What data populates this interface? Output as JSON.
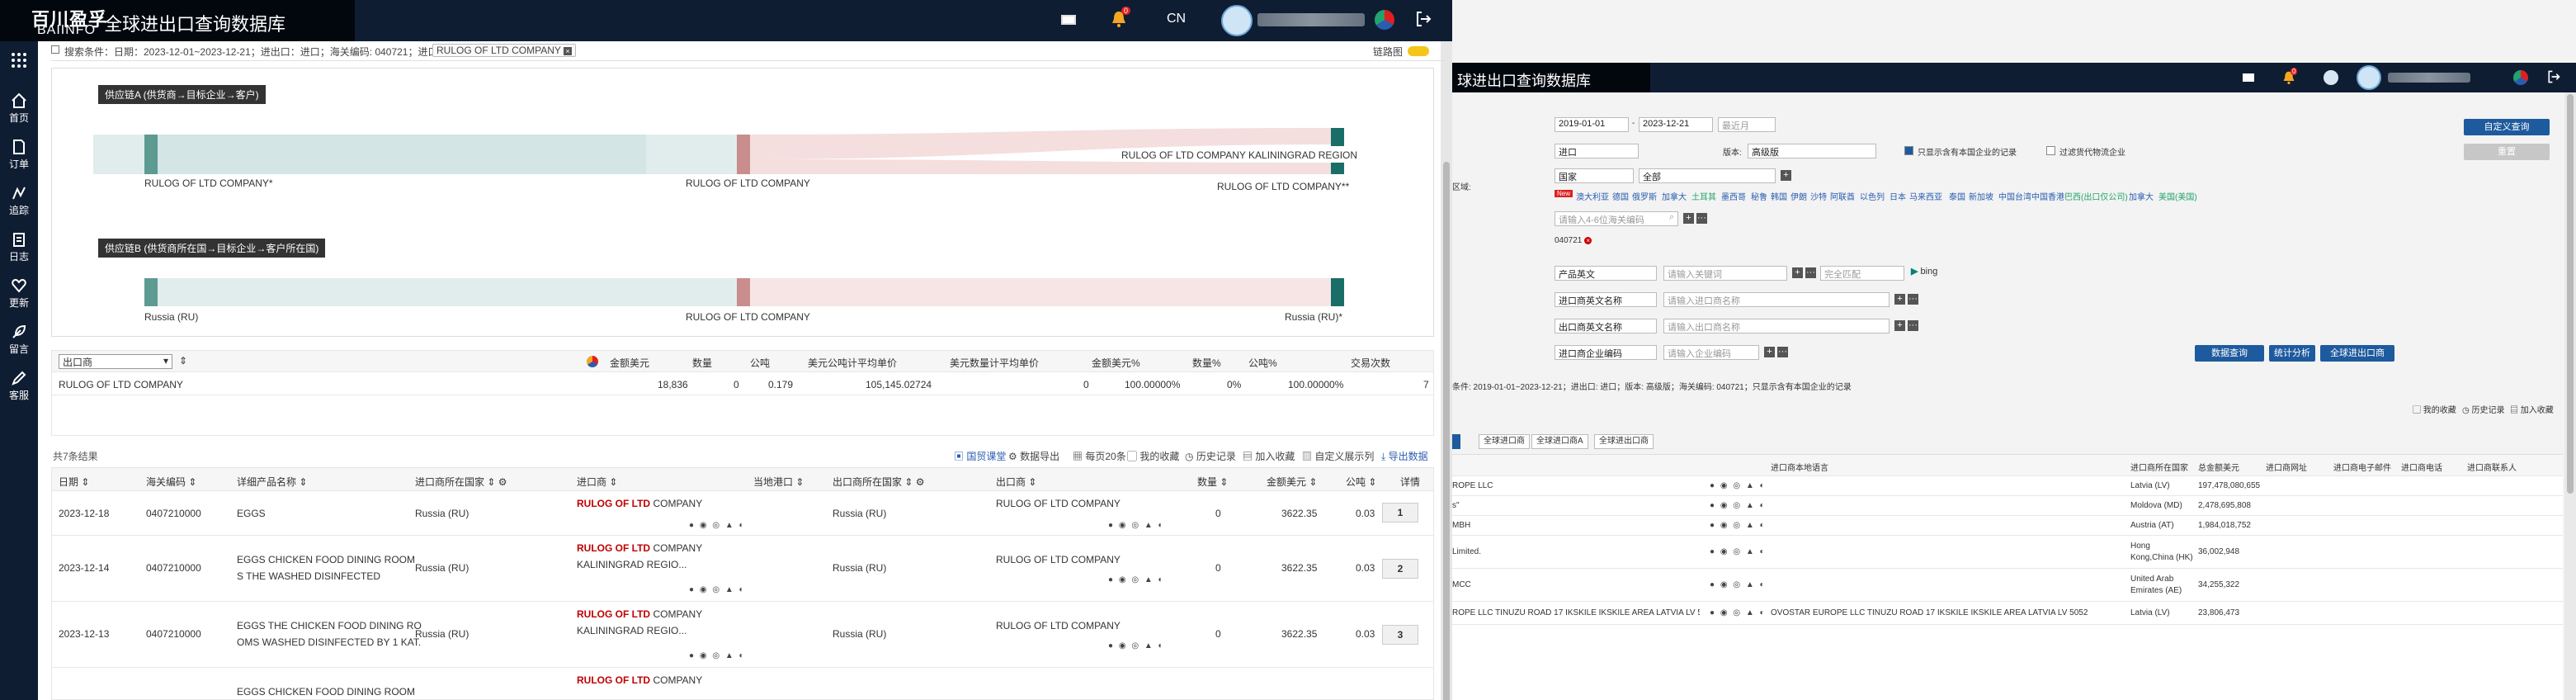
{
  "left": {
    "brand": {
      "cn": "百川盈孚",
      "en": "BAIINFO"
    },
    "app_title": "全球进出口查询数据库",
    "header": {
      "lang": "CN",
      "notice_badge": "0"
    },
    "sidebar": [
      "首页",
      "订单",
      "追踪",
      "日志",
      "更新",
      "留言",
      "客服"
    ],
    "crumb": {
      "label": "搜索条件：日期：2023-12-01~2023-12-21；进出口：进口；海关编码: 040721；进口商:",
      "tag": "RULOG OF LTD COMPANY",
      "switch_label": "链路图"
    },
    "chainA": {
      "title": "供应链A (供货商→目标企业→客户)",
      "left": "RULOG OF LTD COMPANY*",
      "mid": "RULOG OF LTD COMPANY",
      "right1": "RULOG OF LTD COMPANY KALININGRAD REGION",
      "right2": "RULOG OF LTD COMPANY**"
    },
    "chainB": {
      "title": "供应链B (供货商所在国→目标企业→客户所在国)",
      "left": "Russia (RU)",
      "mid": "RULOG OF LTD COMPANY",
      "right": "Russia (RU)*"
    },
    "summary": {
      "select_label": "出口商",
      "headers": [
        "金额美元",
        "数量",
        "公吨",
        "美元公吨计平均单价",
        "美元数量计平均单价",
        "金额美元%",
        "数量%",
        "公吨%",
        "交易次数"
      ],
      "row": {
        "name": "RULOG OF LTD COMPANY",
        "values": [
          "18,836",
          "0",
          "0.179",
          "105,145.02724",
          "0",
          "100.00000%",
          "0%",
          "100.00000%",
          "7"
        ]
      }
    },
    "results": {
      "count": "共7条结果",
      "tools": [
        "国贸课堂",
        "数据导出",
        "每页20条",
        "我的收藏",
        "历史记录",
        "加入收藏",
        "自定义展示列",
        "导出数据"
      ],
      "headers": [
        "日期",
        "海关编码",
        "详细产品名称",
        "进口商所在国家",
        "进口商",
        "当地港口",
        "出口商所在国家",
        "出口商",
        "数量",
        "金额美元",
        "公吨",
        "详情"
      ],
      "rows": [
        {
          "date": "2023-12-18",
          "hs": "0407210000",
          "product": "EGGS",
          "product2": "",
          "country": "Russia (RU)",
          "importer_red": "RULOG OF LTD",
          "importer_rest": " COMPANY",
          "importer2": "",
          "exp_country": "Russia (RU)",
          "exporter": "RULOG OF LTD COMPANY",
          "qty": "0",
          "amount": "3622.35",
          "ton": "0.03",
          "detail": "1"
        },
        {
          "date": "2023-12-14",
          "hs": "0407210000",
          "product": "EGGS CHICKEN FOOD DINING ROOM",
          "product2": "S THE WASHED DISINFECTED",
          "country": "Russia (RU)",
          "importer_red": "RULOG OF LTD",
          "importer_rest": " COMPANY",
          "importer2": "KALININGRAD REGIO...",
          "exp_country": "Russia (RU)",
          "exporter": "RULOG OF LTD COMPANY",
          "qty": "0",
          "amount": "3622.35",
          "ton": "0.03",
          "detail": "2"
        },
        {
          "date": "2023-12-13",
          "hs": "0407210000",
          "product": "EGGS THE CHICKEN FOOD DINING RO",
          "product2": "OMS WASHED DISINFECTED BY 1 KAT.",
          "country": "Russia (RU)",
          "importer_red": "RULOG OF LTD",
          "importer_rest": " COMPANY",
          "importer2": "KALININGRAD REGIO...",
          "exp_country": "Russia (RU)",
          "exporter": "RULOG OF LTD COMPANY",
          "qty": "0",
          "amount": "3622.35",
          "ton": "0.03",
          "detail": "3"
        },
        {
          "date": "",
          "hs": "",
          "product": "EGGS CHICKEN FOOD DINING ROOM",
          "product2": "",
          "country": "",
          "importer_red": "RULOG OF LTD",
          "importer_rest": " COMPANY",
          "importer2": "",
          "exp_country": "",
          "exporter": "",
          "qty": "",
          "amount": "",
          "ton": "",
          "detail": ""
        }
      ]
    }
  },
  "right": {
    "app_title": "球进出口查询数据库",
    "header": {
      "notice_badge": "0"
    },
    "form": {
      "date_from": "2019-01-01",
      "date_to": "2023-12-21",
      "recent": "最近月",
      "io": "进口",
      "version_label": "版本:",
      "version": "高级版",
      "only_cn_label": "只显示含有本国企业的记录",
      "filter_agent_label": "过滤货代物流企业",
      "region_label": "区域:",
      "country_sel": "国家",
      "country_all": "全部",
      "new_badge": "New",
      "countries": [
        "澳大利亚",
        "德国",
        "俄罗斯",
        "加拿大",
        "土耳其",
        "墨西哥",
        "秘鲁",
        "韩国",
        "伊朗",
        "沙特",
        "阿联酋",
        "以色列",
        "日本",
        "马来西亚",
        "泰国",
        "新加坡",
        "中国台湾",
        "中国香港",
        "巴西(出口仅公司)",
        "加拿大",
        "美国(美国)"
      ],
      "hs_placeholder": "请输入4-6位海关编码",
      "hs_tag": "040721",
      "product_sel": "产品英文",
      "keyword_ph": "请输入关键词",
      "match_ph": "完全匹配",
      "bing": "bing",
      "imp_name_sel": "进口商英文名称",
      "imp_name_ph": "请输入进口商名称",
      "exp_name_sel": "出口商英文名称",
      "exp_name_ph": "请输入出口商名称",
      "code_sel": "进口商企业编码",
      "code_ph": "请输入企业编码",
      "btn_search": "数据查询",
      "btn_stats": "统计分析",
      "btn_exporter": "全球进出口商",
      "btn_custom": "自定义查询",
      "btn_reset": "重置"
    },
    "crumb": "条件: 2019-01-01~2023-12-21；进出口: 进口；版本: 高级版；海关编码: 040721；只显示含有本国企业的记录",
    "links": [
      "我的收藏",
      "历史记录",
      "加入收藏"
    ],
    "tabs": [
      "全球进口商",
      "全球进口商A",
      "全球进出口商"
    ],
    "headers": [
      "进口商本地语言",
      "进口商所在国家",
      "总金额美元",
      "进口商网址",
      "进口商电子邮件",
      "进口商电话",
      "进口商联系人"
    ],
    "rows": [
      {
        "name": "ROPE LLC",
        "local": "",
        "country": "Latvia (LV)",
        "amount": "197,478,080,655"
      },
      {
        "name": "s\"",
        "local": "",
        "country": "Moldova (MD)",
        "amount": "2,478,695,808"
      },
      {
        "name": "MBH",
        "local": "",
        "country": "Austria (AT)",
        "amount": "1,984,018,752"
      },
      {
        "name": "Limited.",
        "local": "",
        "country": "Hong Kong,China (HK)",
        "amount": "36,002,948"
      },
      {
        "name": "MCC",
        "local": "",
        "country": "United Arab Emirates (AE)",
        "amount": "34,255,322"
      },
      {
        "name": "ROPE LLC TINUZU ROAD 17 IKSKILE IKSKILE AREA LATVIA LV 5052",
        "local": "OVOSTAR EUROPE LLC TINUZU ROAD 17 IKSKILE IKSKILE AREA LATVIA LV 5052",
        "country": "Latvia (LV)",
        "amount": "23,806,473"
      }
    ]
  }
}
